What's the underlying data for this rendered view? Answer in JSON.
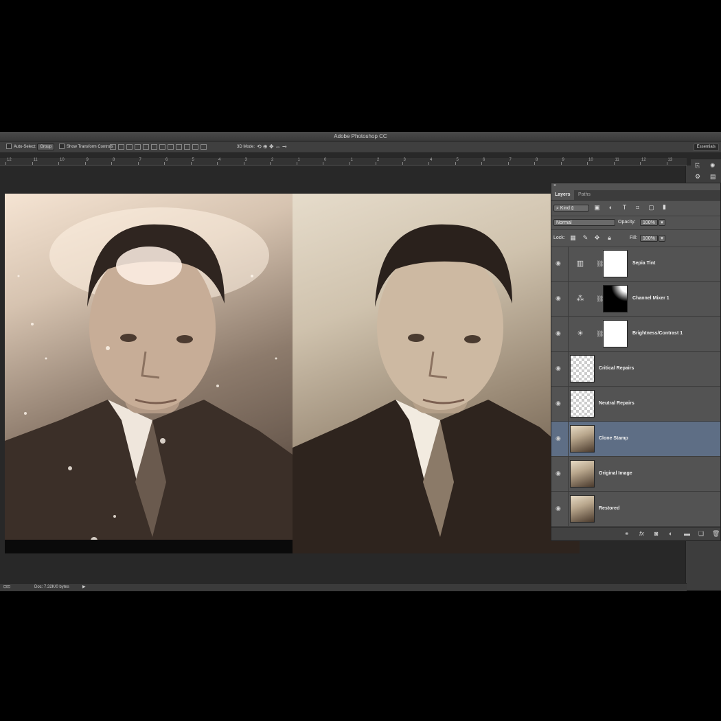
{
  "app": {
    "title": "Adobe Photoshop CC"
  },
  "options_bar": {
    "auto_select_label": "Auto-Select:",
    "auto_select_value": "Group",
    "show_transform_label": "Show Transform Controls",
    "mode_3d_label": "3D Mode:",
    "workspace": "Essentials"
  },
  "ruler": {
    "ticks": [
      "12",
      "11",
      "10",
      "9",
      "8",
      "7",
      "6",
      "5",
      "4",
      "3",
      "2",
      "1",
      "0",
      "1",
      "2",
      "3",
      "4",
      "5",
      "6",
      "7",
      "8",
      "9",
      "10",
      "11",
      "12",
      "13"
    ]
  },
  "status": {
    "doc": "Doc: 7.32K/0 bytes"
  },
  "layers_panel": {
    "close": "×",
    "tabs": [
      "Layers",
      "Paths"
    ],
    "filter_kind": "Kind",
    "blend_mode": "Normal",
    "opacity_label": "Opacity:",
    "opacity_value": "100%",
    "lock_label": "Lock:",
    "fill_label": "Fill:",
    "fill_value": "100%",
    "layers": [
      {
        "name": "Sepia Tint",
        "visible": true,
        "icon": "sepia-adjustment-icon",
        "thumb": "white"
      },
      {
        "name": "Channel Mixer 1",
        "visible": true,
        "icon": "channel-mixer-icon",
        "thumb": "mask"
      },
      {
        "name": "Brightness/Contrast 1",
        "visible": true,
        "icon": "brightness-icon",
        "thumb": "white"
      },
      {
        "name": "Critical Repairs",
        "visible": true,
        "icon": "",
        "thumb": "checker"
      },
      {
        "name": "Neutral Repairs",
        "visible": true,
        "icon": "",
        "thumb": "checker"
      },
      {
        "name": "Clone Stamp",
        "visible": true,
        "icon": "",
        "thumb": "photo",
        "selected": true
      },
      {
        "name": "Original Image",
        "visible": true,
        "icon": "",
        "thumb": "photo"
      },
      {
        "name": "Restored",
        "visible": true,
        "icon": "",
        "thumb": "photo"
      }
    ]
  },
  "colors": {
    "selected_layer": "#5e6e85",
    "panel_bg": "#535353"
  }
}
